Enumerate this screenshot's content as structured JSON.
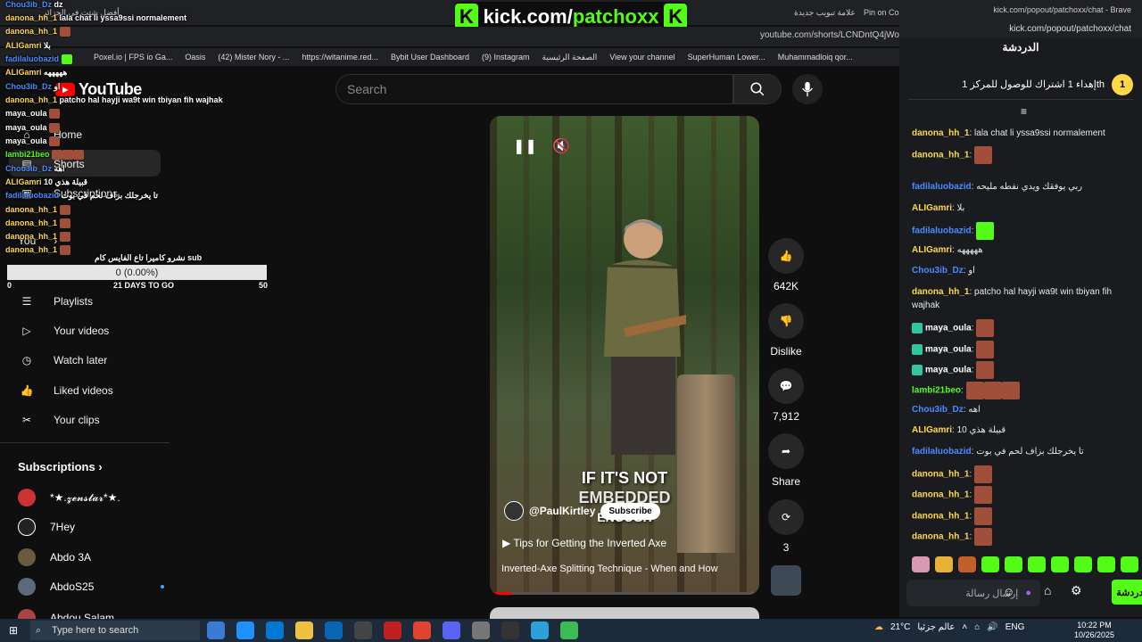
{
  "browser": {
    "tab_left": "أفضل شتت في الجزائر",
    "tab_mid1": "علامة تبويب جديدة",
    "tab_mid2": "Pin on Cosplay",
    "url": "youtube.com/shorts/LCNDntQ4jWo",
    "bookmarks": [
      "Poxel.io | FPS io Ga...",
      "Oasis",
      "(42) Mister Nory - ...",
      "https://witanime.red...",
      "Bybit User Dashboard",
      "(9) Instagram",
      "الصفحة الرئيسية",
      "View your channel",
      "SuperHuman Lower...",
      "Muhammadloiq qor..."
    ]
  },
  "kick_banner": {
    "k": "K",
    "text_a": "kick.com/",
    "text_b": "patchoxx"
  },
  "youtube": {
    "logo": "YouTube",
    "search_placeholder": "Search",
    "sidebar": {
      "home": "Home",
      "shorts": "Shorts",
      "subscriptions": "Subscriptions",
      "you": "You",
      "playlists": "Playlists",
      "your_videos": "Your videos",
      "watch_later": "Watch later",
      "liked_videos": "Liked videos",
      "your_clips": "Your clips",
      "subs_heading": "Subscriptions",
      "subs": [
        "*★.𝔃𝓮𝓷𝓼𝓽𝓪𝓻*★.",
        "7Hey",
        "Abdo 3A",
        "AbdoS25",
        "Abdou Salam"
      ]
    },
    "video": {
      "caption1": "IF IT'S NOT",
      "caption2": "EMBEDDED",
      "caption3": "ENOUGH",
      "channel": "@PaulKirtley",
      "subscribe": "Subscribe",
      "playlist_title": "Tips for Getting the Inverted Axe",
      "title": "Inverted-Axe Splitting Technique - When and How",
      "progress": 0.08
    },
    "actions": {
      "likes": "642K",
      "dislike": "Dislike",
      "comments": "7,912",
      "share": "Share",
      "remix": "3"
    }
  },
  "overlay_chat": {
    "lines": [
      {
        "user": "Chou3ib_Dz",
        "text": "dz",
        "color": "blue"
      },
      {
        "user": "danona_hh_1",
        "text": "lala chat li yssa9ssi normalement",
        "color": "yellow"
      },
      {
        "user": "danona_hh_1",
        "text": "",
        "color": "yellow"
      },
      {
        "user": "ALIGamri",
        "text": "بلا",
        "color": "yellow"
      },
      {
        "user": "fadilaluobazid",
        "text": "",
        "color": "blue"
      },
      {
        "user": "ALIGamri",
        "text": "هههههه",
        "color": "yellow"
      },
      {
        "user": "Chou3ib_Dz",
        "text": "او",
        "color": "blue"
      },
      {
        "user": "danona_hh_1",
        "text": "patcho hal hayji wa9t win tbiyan fih wajhak",
        "color": "yellow"
      },
      {
        "user": "maya_oula",
        "text": "",
        "color": "white"
      },
      {
        "user": "maya_oula",
        "text": "",
        "color": "white"
      },
      {
        "user": "maya_oula",
        "text": "",
        "color": "white"
      },
      {
        "user": "lambi21beo",
        "text": "",
        "color": "green"
      },
      {
        "user": "Chou3ib_Dz",
        "text": "اهه",
        "color": "blue"
      },
      {
        "user": "ALIGamri",
        "text": "10 قبيلة هذي",
        "color": "yellow"
      },
      {
        "user": "fadilaluobazid",
        "text": "تا يخرجلك بزاف لحم في بوت",
        "color": "blue"
      },
      {
        "user": "danona_hh_1",
        "text": "",
        "color": "yellow"
      },
      {
        "user": "danona_hh_1",
        "text": "",
        "color": "yellow"
      },
      {
        "user": "danona_hh_1",
        "text": "",
        "color": "yellow"
      },
      {
        "user": "danona_hh_1",
        "text": "",
        "color": "yellow"
      }
    ],
    "sub_goal_label": "نشرو كاميرا تاع الفايس كام sub",
    "sub_goal_value": "0 (0.00%)",
    "sub_goal_min": "0",
    "sub_goal_days": "21 DAYS TO GO",
    "sub_goal_max": "50"
  },
  "chat_panel": {
    "window_title": "kick.com/popout/patchoxx/chat - Brave",
    "url": "kick.com/popout/patchoxx/chat",
    "title": "الدردشة",
    "goal_num": "1",
    "goal_text": "إهداء 1 اشتراك للوصول للمركز 1th",
    "messages": [
      {
        "user": "danona_hh_1",
        "text": "lala chat li yssa9ssi normalement",
        "color": "#ffd84a"
      },
      {
        "user": "danona_hh_1",
        "text": "",
        "color": "#ffd84a"
      },
      {
        "user": "fadilaluobazid",
        "text": "ربي يوفقك ويدي نفطه مليحه",
        "color": "#4a8cff"
      },
      {
        "user": "ALIGamri",
        "text": "بلا",
        "color": "#ffd84a"
      },
      {
        "user": "fadilaluobazid",
        "text": "",
        "color": "#4a8cff"
      },
      {
        "user": "ALIGamri",
        "text": "هههههه",
        "color": "#ffd84a"
      },
      {
        "user": "Chou3ib_Dz",
        "text": "او",
        "color": "#4a8cff"
      },
      {
        "user": "danona_hh_1",
        "text": "patcho hal hayji wa9t win tbiyan fih wajhak",
        "color": "#ffd84a"
      },
      {
        "user": "maya_oula",
        "text": "",
        "color": "#ffffff"
      },
      {
        "user": "maya_oula",
        "text": "",
        "color": "#ffffff"
      },
      {
        "user": "maya_oula",
        "text": "",
        "color": "#ffffff"
      },
      {
        "user": "lambi21beo",
        "text": "",
        "color": "#53fc18"
      },
      {
        "user": "Chou3ib_Dz",
        "text": "اهه",
        "color": "#4a8cff"
      },
      {
        "user": "ALIGamri",
        "text": "10 قبيلة هذي",
        "color": "#ffd84a"
      },
      {
        "user": "fadilaluobazid",
        "text": "تا يخرجلك بزاف لحم في بوت",
        "color": "#4a8cff"
      },
      {
        "user": "danona_hh_1",
        "text": "",
        "color": "#ffd84a"
      },
      {
        "user": "danona_hh_1",
        "text": "",
        "color": "#ffd84a"
      },
      {
        "user": "danona_hh_1",
        "text": "",
        "color": "#ffd84a"
      },
      {
        "user": "danona_hh_1",
        "text": "",
        "color": "#ffd84a"
      }
    ],
    "input_placeholder": "إرسال رسالة",
    "send_label": "الدردشة"
  },
  "taskbar": {
    "search_placeholder": "Type here to search",
    "weather": "21°C",
    "weather_text": "عالم جزئيا",
    "lang": "ENG",
    "time": "10:22 PM",
    "date": "10/26/2025"
  }
}
